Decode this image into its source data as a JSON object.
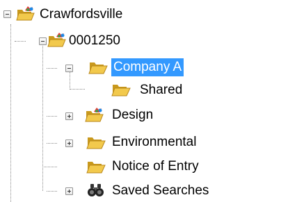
{
  "tree": {
    "nodes": [
      {
        "id": "crawfordsville",
        "label": "Crawfordsville",
        "icon": "location-folder-icon",
        "expander": "minus"
      },
      {
        "id": "0001250",
        "label": "0001250",
        "icon": "location-folder-icon",
        "expander": "minus"
      },
      {
        "id": "company-a",
        "label": "Company A",
        "icon": "open-folder-icon",
        "expander": "minus",
        "selected": true
      },
      {
        "id": "shared",
        "label": "Shared",
        "icon": "open-folder-icon",
        "expander": "none"
      },
      {
        "id": "design",
        "label": "Design",
        "icon": "location-folder-icon",
        "expander": "plus"
      },
      {
        "id": "environmental",
        "label": "Environmental",
        "icon": "folder-icon",
        "expander": "plus"
      },
      {
        "id": "notice-of-entry",
        "label": "Notice of Entry",
        "icon": "folder-icon",
        "expander": "none"
      },
      {
        "id": "saved-searches",
        "label": "Saved Searches",
        "icon": "binoculars-icon",
        "expander": "plus"
      }
    ]
  },
  "colors": {
    "selection": "#3399ff",
    "folder": "#f2c94c",
    "folder_dark": "#c9991d"
  }
}
